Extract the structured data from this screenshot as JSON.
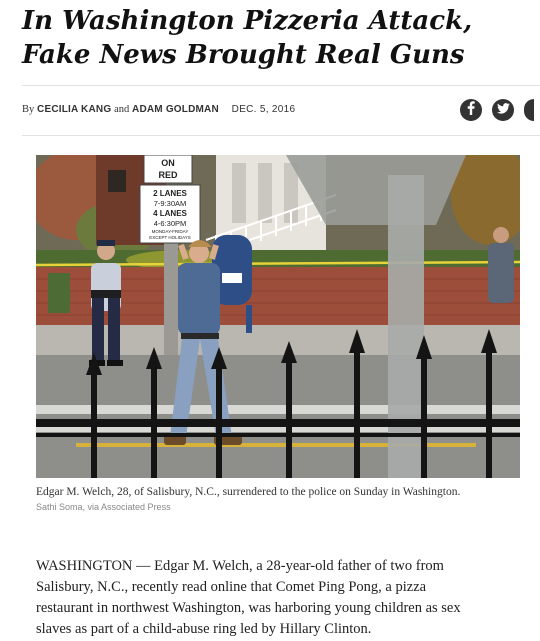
{
  "article": {
    "headline_line1": "In Washington Pizzeria Attack,",
    "headline_line2": "Fake News Brought Real Guns",
    "byline": {
      "prefix": "By",
      "author1": "CECILIA KANG",
      "conjunction": "and",
      "author2": "ADAM GOLDMAN",
      "date": "DEC. 5, 2016"
    },
    "share_icons": [
      "facebook-icon",
      "twitter-icon",
      "more-share-icon"
    ],
    "photo": {
      "sign_on_red": [
        "ON",
        "RED"
      ],
      "sign_lanes": [
        "2 LANES",
        "7-9:30AM",
        "4 LANES",
        "4-6:30PM",
        "MONDAY-FRIDAY",
        "EXCEPT HOLIDAYS"
      ]
    },
    "caption": "Edgar M. Welch, 28, of Salisbury, N.C., surrendered to the police on Sunday in Washington.",
    "credit": "Sathi Soma, via Associated Press",
    "body_lines": [
      "WASHINGTON — Edgar M. Welch, a 28-year-old father of two from",
      "Salisbury, N.C., recently read online that Comet Ping Pong, a pizza",
      "restaurant in northwest Washington, was harboring young children as sex",
      "slaves as part of a child-abuse ring led by Hillary Clinton."
    ]
  },
  "colors": {
    "icon_bg": "#333333",
    "rule": "#e2e2e2",
    "police_tape": "#e8d23a"
  }
}
